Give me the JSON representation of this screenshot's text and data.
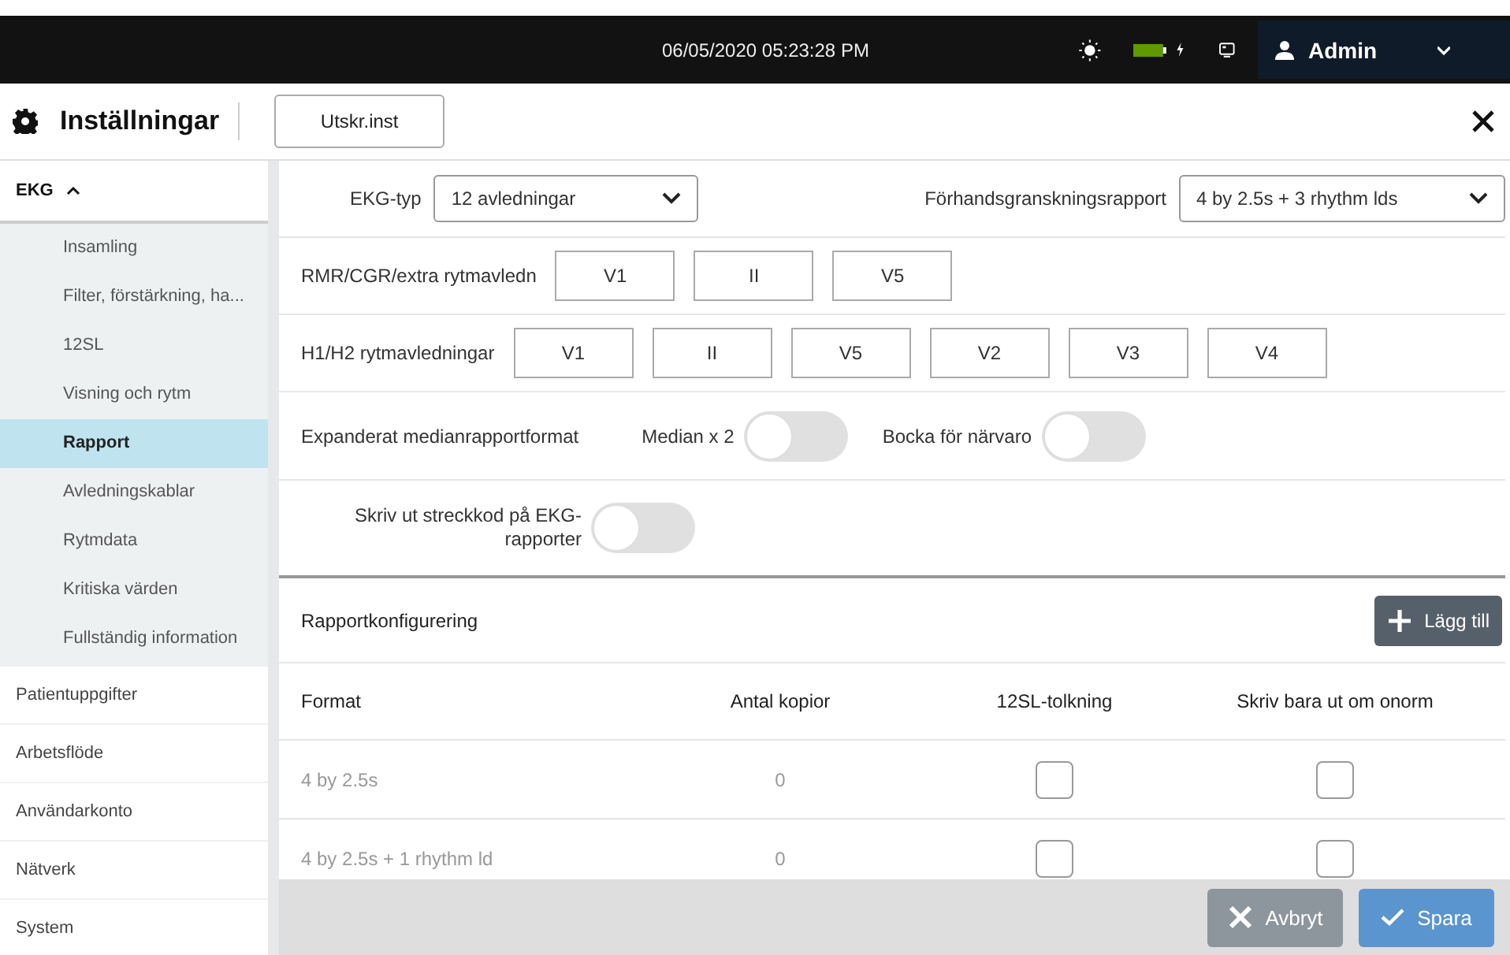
{
  "status_bar": {
    "datetime": "06/05/2020 05:23:28 PM",
    "charging": true,
    "user": "Admin"
  },
  "header": {
    "title": "Inställningar",
    "button": "Utskr.inst"
  },
  "sidebar": {
    "section": {
      "label": "EKG",
      "expanded": true,
      "items": [
        {
          "label": "Insamling",
          "selected": false
        },
        {
          "label": "Filter, förstärkning, ha...",
          "selected": false
        },
        {
          "label": "12SL",
          "selected": false
        },
        {
          "label": "Visning och rytm",
          "selected": false
        },
        {
          "label": "Rapport",
          "selected": true
        },
        {
          "label": "Avledningskablar",
          "selected": false
        },
        {
          "label": "Rytmdata",
          "selected": false
        },
        {
          "label": "Kritiska värden",
          "selected": false
        },
        {
          "label": "Fullständig information",
          "selected": false
        }
      ]
    },
    "items": [
      "Patientuppgifter",
      "Arbetsflöde",
      "Användarkonto",
      "Nätverk",
      "System"
    ]
  },
  "settings": [
    {
      "kind": "selects",
      "fields": [
        {
          "label": "EKG-typ",
          "value": "12 avledningar"
        },
        {
          "label": "Förhandsgranskningsrapport",
          "value": "4 by 2.5s + 3 rhythm lds"
        }
      ]
    },
    {
      "kind": "leads",
      "label": "RMR/CGR/extra rytmavledn",
      "leads": [
        "V1",
        "II",
        "V5"
      ]
    },
    {
      "kind": "leads",
      "label": "H1/H2 rytmavledningar",
      "leads": [
        "V1",
        "II",
        "V5",
        "V2",
        "V3",
        "V4"
      ]
    },
    {
      "kind": "toggles",
      "label": "Expanderat medianrapportformat",
      "toggles": [
        {
          "label": "Median x 2",
          "on": false
        },
        {
          "label": "Bocka för närvaro",
          "on": false
        }
      ]
    },
    {
      "kind": "toggle",
      "label": "Skriv ut streckkod på EKG-rapporter",
      "on": false
    }
  ],
  "report": {
    "title": "Rapportkonfigurering",
    "add_button": "Lägg till",
    "columns": [
      "Format",
      "Antal kopior",
      "12SL-tolkning",
      "Skriv bara ut om onorm"
    ],
    "rows": [
      {
        "format": "4 by 2.5s",
        "copies": "0",
        "interpretation": false,
        "abnormal_only": false
      },
      {
        "format": "4 by 2.5s + 1 rhythm ld",
        "copies": "0",
        "interpretation": false,
        "abnormal_only": false
      }
    ]
  },
  "footer": {
    "buttons": [
      {
        "kind": "cancel",
        "label": "Avbryt",
        "disabled": true
      },
      {
        "kind": "save",
        "label": "Spara",
        "disabled": true
      }
    ]
  }
}
